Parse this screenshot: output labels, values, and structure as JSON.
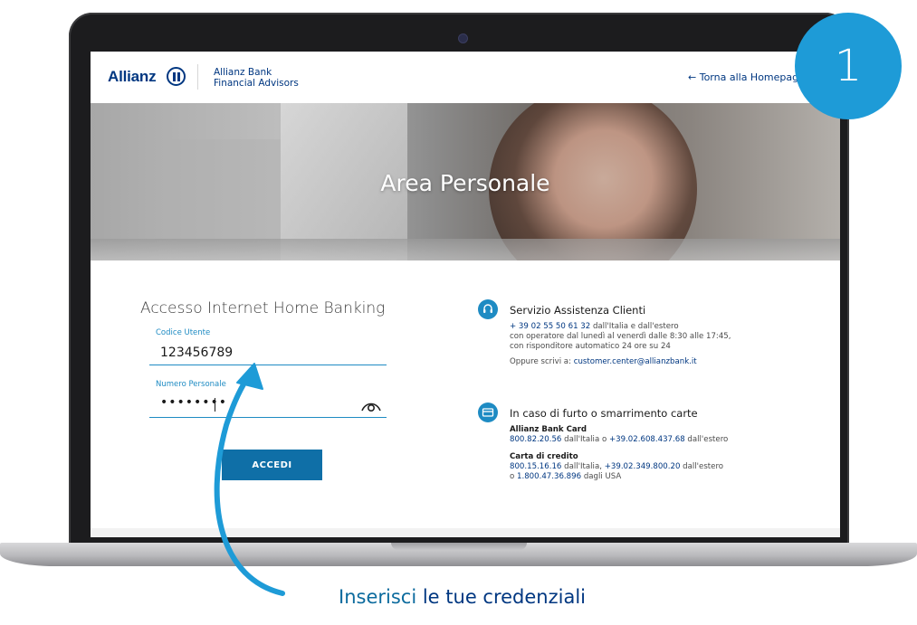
{
  "header": {
    "brand": "Allianz",
    "bank_line1": "Allianz Bank",
    "bank_line2": "Financial Advisors",
    "back_link": "Torna alla Homepage",
    "back_arrow": "←"
  },
  "hero": {
    "title": "Area Personale"
  },
  "login": {
    "title": "Accesso Internet Home Banking",
    "user_label": "Codice Utente",
    "user_value": "123456789",
    "pin_label": "Numero Personale",
    "pin_value": "••••••••",
    "submit_label": "ACCEDI"
  },
  "support": {
    "title": "Servizio Assistenza Clienti",
    "phone": "+ 39 02 55 50 61 32",
    "phone_note": "dall'Italia e dall'estero",
    "hours_line": "con operatore dal lunedì al venerdì dalle 8:30 alle 17:45,",
    "auto_line": "con risponditore automatico 24 ore su 24",
    "write_prefix": "Oppure scrivi a:",
    "email": "customer.center@allianzbank.it"
  },
  "theft": {
    "title": "In caso di furto o smarrimento carte",
    "card1_name": "Allianz Bank Card",
    "card1_it": "800.82.20.56",
    "card1_mid": "dall'Italia o",
    "card1_abroad": "+39.02.608.437.68",
    "card1_end": "dall'estero",
    "card2_name": "Carta di credito",
    "card2_it": "800.15.16.16",
    "card2_mid": "dall'Italia,",
    "card2_abroad": "+39.02.349.800.20",
    "card2_end": "dall'estero",
    "card2_usa_prefix": "o",
    "card2_usa": "1.800.47.36.896",
    "card2_usa_end": "dagli USA"
  },
  "step": {
    "number": "1"
  },
  "annotation": {
    "caption_plain": "Inserisci",
    "caption_strong": "le tue credenziali"
  },
  "colors": {
    "accent": "#1e9bd7",
    "brand": "#003781",
    "button": "#0f6fa7"
  },
  "icons": [
    "allianz-logo-icon",
    "arrow-left-icon",
    "eye-icon",
    "headset-icon",
    "card-icon",
    "curved-arrow-icon"
  ]
}
